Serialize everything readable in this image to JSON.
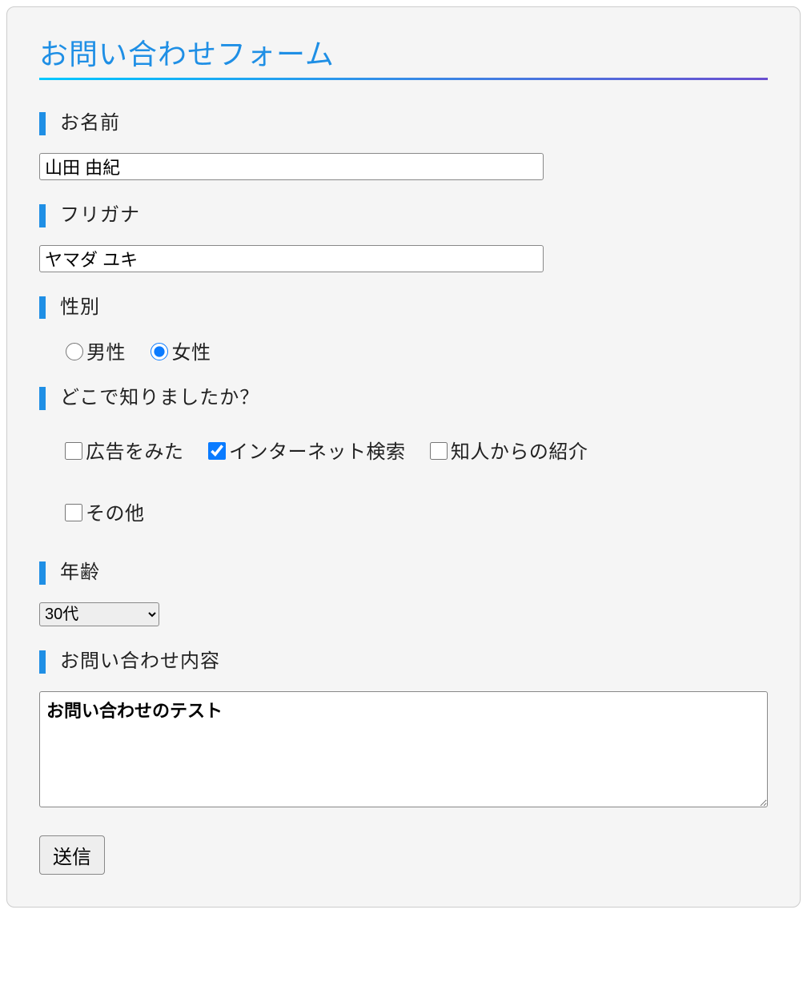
{
  "title": "お問い合わせフォーム",
  "labels": {
    "name": "お名前",
    "kana": "フリガナ",
    "gender": "性別",
    "source": "どこで知りましたか？",
    "age": "年齢",
    "body": "お問い合わせ内容"
  },
  "values": {
    "name": "山田 由紀",
    "kana": "ヤマダ ユキ",
    "gender_selected": "女性",
    "source_checked": [
      "インターネット検索"
    ],
    "age_selected": "30代",
    "body": "お問い合わせのテスト"
  },
  "gender_options": {
    "male": "男性",
    "female": "女性"
  },
  "source_options": {
    "ad": "広告をみた",
    "internet": "インターネット検索",
    "referral": "知人からの紹介",
    "other": "その他"
  },
  "age_options": [
    "30代"
  ],
  "submit_label": "送信"
}
